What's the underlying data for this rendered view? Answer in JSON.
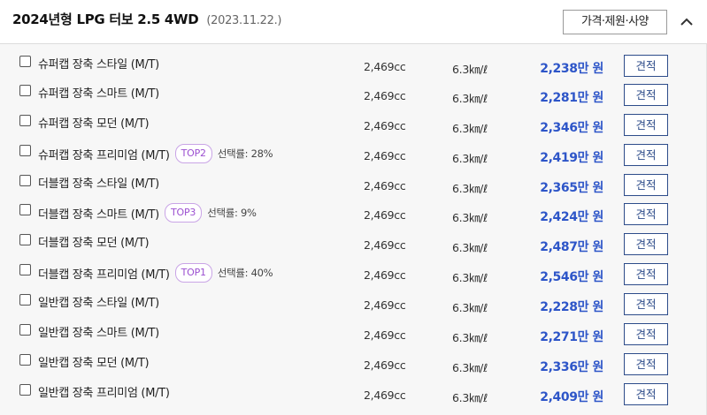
{
  "header": {
    "title": "2024년형 LPG 터보 2.5 4WD",
    "date": "(2023.11.22.)",
    "spec_button": "가격·제원·사양",
    "collapse_icon": "chevron-up-icon"
  },
  "quote_label": "견적",
  "accent_color": "#2d55c8",
  "trims": [
    {
      "name": "슈퍼캡 장축 스타일 (M/T)",
      "displacement": "2,469cc",
      "efficiency": "6.3㎞/ℓ",
      "price": "2,238만 원",
      "badge": "",
      "rate": ""
    },
    {
      "name": "슈퍼캡 장축 스마트 (M/T)",
      "displacement": "2,469cc",
      "efficiency": "6.3㎞/ℓ",
      "price": "2,281만 원",
      "badge": "",
      "rate": ""
    },
    {
      "name": "슈퍼캡 장축 모던 (M/T)",
      "displacement": "2,469cc",
      "efficiency": "6.3㎞/ℓ",
      "price": "2,346만 원",
      "badge": "",
      "rate": ""
    },
    {
      "name": "슈퍼캡 장축 프리미엄 (M/T)",
      "displacement": "2,469cc",
      "efficiency": "6.3㎞/ℓ",
      "price": "2,419만 원",
      "badge": "TOP2",
      "rate": "선택률: 28%"
    },
    {
      "name": "더블캡 장축 스타일 (M/T)",
      "displacement": "2,469cc",
      "efficiency": "6.3㎞/ℓ",
      "price": "2,365만 원",
      "badge": "",
      "rate": ""
    },
    {
      "name": "더블캡 장축 스마트 (M/T)",
      "displacement": "2,469cc",
      "efficiency": "6.3㎞/ℓ",
      "price": "2,424만 원",
      "badge": "TOP3",
      "rate": "선택률: 9%"
    },
    {
      "name": "더블캡 장축 모던 (M/T)",
      "displacement": "2,469cc",
      "efficiency": "6.3㎞/ℓ",
      "price": "2,487만 원",
      "badge": "",
      "rate": ""
    },
    {
      "name": "더블캡 장축 프리미엄 (M/T)",
      "displacement": "2,469cc",
      "efficiency": "6.3㎞/ℓ",
      "price": "2,546만 원",
      "badge": "TOP1",
      "rate": "선택률: 40%"
    },
    {
      "name": "일반캡 장축 스타일 (M/T)",
      "displacement": "2,469cc",
      "efficiency": "6.3㎞/ℓ",
      "price": "2,228만 원",
      "badge": "",
      "rate": ""
    },
    {
      "name": "일반캡 장축 스마트 (M/T)",
      "displacement": "2,469cc",
      "efficiency": "6.3㎞/ℓ",
      "price": "2,271만 원",
      "badge": "",
      "rate": ""
    },
    {
      "name": "일반캡 장축 모던 (M/T)",
      "displacement": "2,469cc",
      "efficiency": "6.3㎞/ℓ",
      "price": "2,336만 원",
      "badge": "",
      "rate": ""
    },
    {
      "name": "일반캡 장축 프리미엄 (M/T)",
      "displacement": "2,469cc",
      "efficiency": "6.3㎞/ℓ",
      "price": "2,409만 원",
      "badge": "",
      "rate": ""
    }
  ]
}
